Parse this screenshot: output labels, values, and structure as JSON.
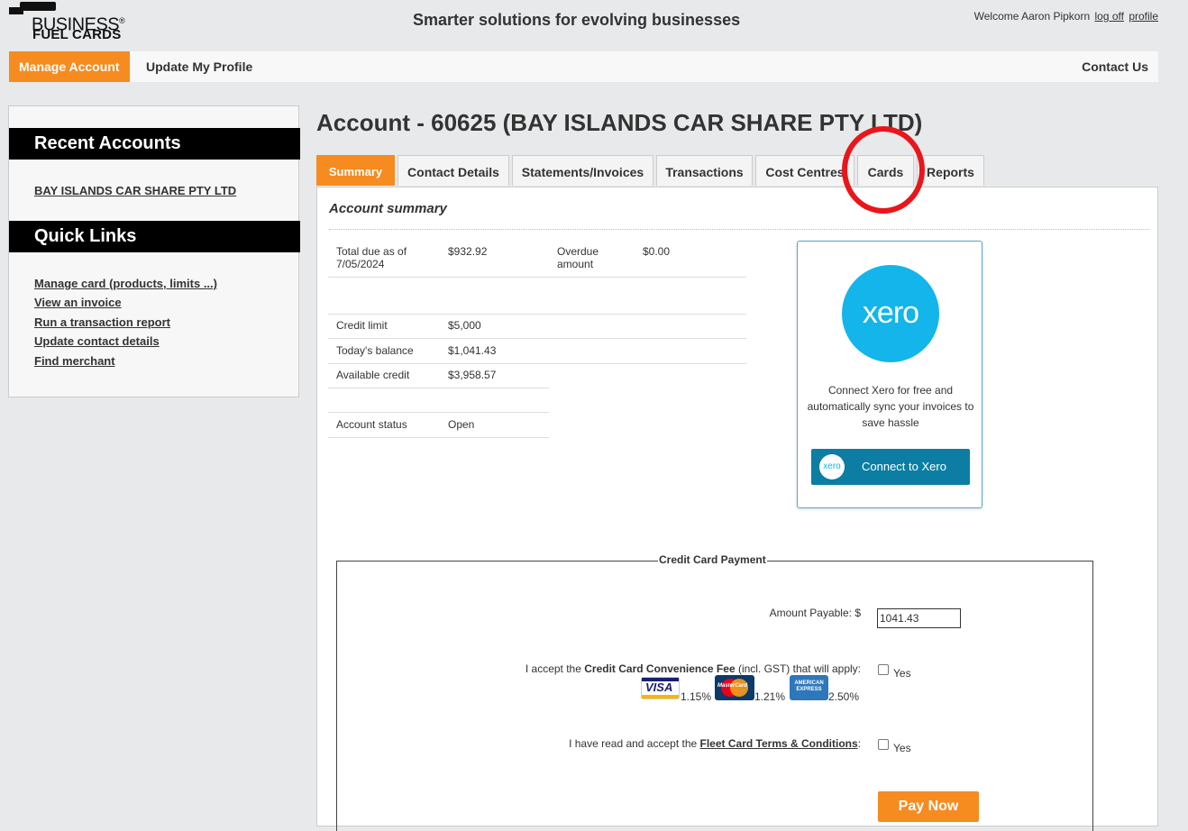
{
  "header": {
    "logo_line1": "BUSINESS",
    "logo_line2": "FUEL CARDS",
    "tagline": "Smarter solutions for evolving businesses",
    "welcome_text": "Welcome Aaron Pipkorn",
    "logoff_label": "log off",
    "profile_label": "profile"
  },
  "nav": {
    "manage_account": "Manage Account",
    "update_profile": "Update My Profile",
    "contact_us": "Contact Us"
  },
  "sidebar": {
    "recent_title": "Recent Accounts",
    "recent_items": [
      "BAY ISLANDS CAR SHARE PTY LTD"
    ],
    "quick_title": "Quick Links",
    "quick_links": [
      "Manage card (products, limits ...)",
      "View an invoice",
      "Run a transaction report",
      "Update contact details",
      "Find merchant"
    ]
  },
  "main": {
    "title": "Account - 60625 (BAY ISLANDS CAR SHARE PTY LTD)",
    "tabs": [
      "Summary",
      "Contact Details",
      "Statements/Invoices",
      "Transactions",
      "Cost Centres",
      "Cards",
      "Reports"
    ],
    "active_tab": "Summary",
    "summary_title": "Account summary",
    "summary": {
      "total_due_label": "Total due as of 7/05/2024",
      "total_due_value": "$932.92",
      "overdue_label": "Overdue amount",
      "overdue_value": "$0.00",
      "credit_limit_label": "Credit limit",
      "credit_limit_value": "$5,000",
      "balance_label": "Today's balance",
      "balance_value": "$1,041.43",
      "available_label": "Available credit",
      "available_value": "$3,958.57",
      "status_label": "Account status",
      "status_value": "Open"
    }
  },
  "xero": {
    "logo_text": "xero",
    "description": "Connect Xero for free and automatically sync your invoices to save hassle",
    "button_label": "Connect to Xero",
    "brand_color": "#13b5ea"
  },
  "payment": {
    "legend": "Credit Card Payment",
    "amount_label": "Amount Payable: $",
    "amount_value": "1041.43",
    "fee_prefix": "I accept the ",
    "fee_strong": "Credit Card Convenience Fee",
    "fee_suffix": " (incl. GST) that will apply:",
    "fees": [
      {
        "card": "VISA",
        "rate": "1.15%"
      },
      {
        "card": "MasterCard",
        "rate": "1.21%"
      },
      {
        "card": "AMERICAN EXPRESS",
        "rate": "2.50%"
      }
    ],
    "yes_label": "Yes",
    "terms_prefix": "I have read and accept the ",
    "terms_link": "Fleet Card Terms & Conditions",
    "terms_suffix": ":",
    "pay_button": "Pay Now"
  },
  "colors": {
    "accent": "#f68b1f",
    "annotation": "#e8161b"
  }
}
